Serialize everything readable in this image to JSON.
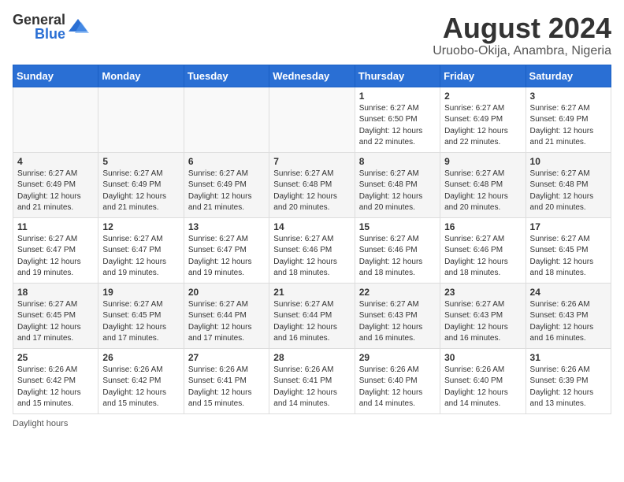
{
  "logo": {
    "text1": "General",
    "text2": "Blue"
  },
  "header": {
    "title": "August 2024",
    "subtitle": "Uruobo-Okija, Anambra, Nigeria"
  },
  "weekdays": [
    "Sunday",
    "Monday",
    "Tuesday",
    "Wednesday",
    "Thursday",
    "Friday",
    "Saturday"
  ],
  "weeks": [
    [
      {
        "day": "",
        "info": ""
      },
      {
        "day": "",
        "info": ""
      },
      {
        "day": "",
        "info": ""
      },
      {
        "day": "",
        "info": ""
      },
      {
        "day": "1",
        "info": "Sunrise: 6:27 AM\nSunset: 6:50 PM\nDaylight: 12 hours\nand 22 minutes."
      },
      {
        "day": "2",
        "info": "Sunrise: 6:27 AM\nSunset: 6:49 PM\nDaylight: 12 hours\nand 22 minutes."
      },
      {
        "day": "3",
        "info": "Sunrise: 6:27 AM\nSunset: 6:49 PM\nDaylight: 12 hours\nand 21 minutes."
      }
    ],
    [
      {
        "day": "4",
        "info": "Sunrise: 6:27 AM\nSunset: 6:49 PM\nDaylight: 12 hours\nand 21 minutes."
      },
      {
        "day": "5",
        "info": "Sunrise: 6:27 AM\nSunset: 6:49 PM\nDaylight: 12 hours\nand 21 minutes."
      },
      {
        "day": "6",
        "info": "Sunrise: 6:27 AM\nSunset: 6:49 PM\nDaylight: 12 hours\nand 21 minutes."
      },
      {
        "day": "7",
        "info": "Sunrise: 6:27 AM\nSunset: 6:48 PM\nDaylight: 12 hours\nand 20 minutes."
      },
      {
        "day": "8",
        "info": "Sunrise: 6:27 AM\nSunset: 6:48 PM\nDaylight: 12 hours\nand 20 minutes."
      },
      {
        "day": "9",
        "info": "Sunrise: 6:27 AM\nSunset: 6:48 PM\nDaylight: 12 hours\nand 20 minutes."
      },
      {
        "day": "10",
        "info": "Sunrise: 6:27 AM\nSunset: 6:48 PM\nDaylight: 12 hours\nand 20 minutes."
      }
    ],
    [
      {
        "day": "11",
        "info": "Sunrise: 6:27 AM\nSunset: 6:47 PM\nDaylight: 12 hours\nand 19 minutes."
      },
      {
        "day": "12",
        "info": "Sunrise: 6:27 AM\nSunset: 6:47 PM\nDaylight: 12 hours\nand 19 minutes."
      },
      {
        "day": "13",
        "info": "Sunrise: 6:27 AM\nSunset: 6:47 PM\nDaylight: 12 hours\nand 19 minutes."
      },
      {
        "day": "14",
        "info": "Sunrise: 6:27 AM\nSunset: 6:46 PM\nDaylight: 12 hours\nand 18 minutes."
      },
      {
        "day": "15",
        "info": "Sunrise: 6:27 AM\nSunset: 6:46 PM\nDaylight: 12 hours\nand 18 minutes."
      },
      {
        "day": "16",
        "info": "Sunrise: 6:27 AM\nSunset: 6:46 PM\nDaylight: 12 hours\nand 18 minutes."
      },
      {
        "day": "17",
        "info": "Sunrise: 6:27 AM\nSunset: 6:45 PM\nDaylight: 12 hours\nand 18 minutes."
      }
    ],
    [
      {
        "day": "18",
        "info": "Sunrise: 6:27 AM\nSunset: 6:45 PM\nDaylight: 12 hours\nand 17 minutes."
      },
      {
        "day": "19",
        "info": "Sunrise: 6:27 AM\nSunset: 6:45 PM\nDaylight: 12 hours\nand 17 minutes."
      },
      {
        "day": "20",
        "info": "Sunrise: 6:27 AM\nSunset: 6:44 PM\nDaylight: 12 hours\nand 17 minutes."
      },
      {
        "day": "21",
        "info": "Sunrise: 6:27 AM\nSunset: 6:44 PM\nDaylight: 12 hours\nand 16 minutes."
      },
      {
        "day": "22",
        "info": "Sunrise: 6:27 AM\nSunset: 6:43 PM\nDaylight: 12 hours\nand 16 minutes."
      },
      {
        "day": "23",
        "info": "Sunrise: 6:27 AM\nSunset: 6:43 PM\nDaylight: 12 hours\nand 16 minutes."
      },
      {
        "day": "24",
        "info": "Sunrise: 6:26 AM\nSunset: 6:43 PM\nDaylight: 12 hours\nand 16 minutes."
      }
    ],
    [
      {
        "day": "25",
        "info": "Sunrise: 6:26 AM\nSunset: 6:42 PM\nDaylight: 12 hours\nand 15 minutes."
      },
      {
        "day": "26",
        "info": "Sunrise: 6:26 AM\nSunset: 6:42 PM\nDaylight: 12 hours\nand 15 minutes."
      },
      {
        "day": "27",
        "info": "Sunrise: 6:26 AM\nSunset: 6:41 PM\nDaylight: 12 hours\nand 15 minutes."
      },
      {
        "day": "28",
        "info": "Sunrise: 6:26 AM\nSunset: 6:41 PM\nDaylight: 12 hours\nand 14 minutes."
      },
      {
        "day": "29",
        "info": "Sunrise: 6:26 AM\nSunset: 6:40 PM\nDaylight: 12 hours\nand 14 minutes."
      },
      {
        "day": "30",
        "info": "Sunrise: 6:26 AM\nSunset: 6:40 PM\nDaylight: 12 hours\nand 14 minutes."
      },
      {
        "day": "31",
        "info": "Sunrise: 6:26 AM\nSunset: 6:39 PM\nDaylight: 12 hours\nand 13 minutes."
      }
    ]
  ],
  "footer": {
    "label": "Daylight hours"
  }
}
